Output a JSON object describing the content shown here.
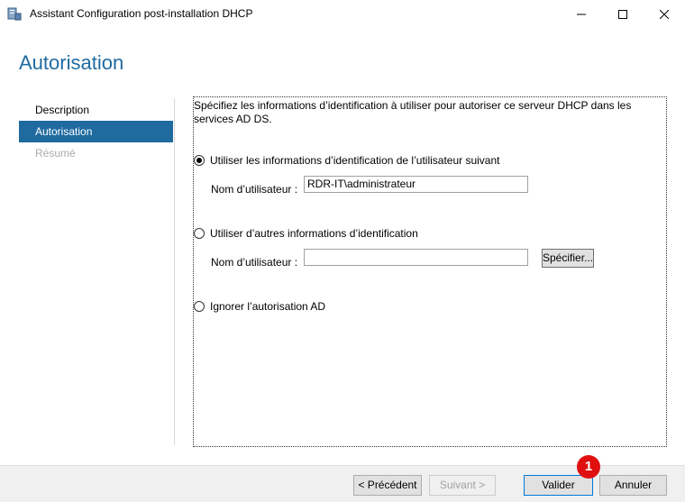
{
  "window": {
    "title": "Assistant Configuration post-installation DHCP",
    "icon": "server-wizard-icon"
  },
  "page_title": "Autorisation",
  "nav": {
    "items": [
      {
        "label": "Description",
        "state": "normal"
      },
      {
        "label": "Autorisation",
        "state": "active"
      },
      {
        "label": "Résumé",
        "state": "disabled"
      }
    ]
  },
  "main": {
    "intro": "Spécifiez les informations d’identification à utiliser pour autoriser ce serveur DHCP dans les services AD DS.",
    "option_current_user": {
      "label": "Utiliser les informations d’identification de l’utilisateur suivant",
      "checked": true,
      "username_label": "Nom d’utilisateur :",
      "username_value": "RDR-IT\\administrateur"
    },
    "option_other_user": {
      "label": "Utiliser d’autres informations d’identification",
      "checked": false,
      "username_label": "Nom d’utilisateur :",
      "username_value": "",
      "specify_label": "Spécifier..."
    },
    "option_skip": {
      "label": "Ignorer l’autorisation AD",
      "checked": false
    }
  },
  "footer": {
    "prev_label": "< Précédent",
    "next_label": "Suivant >",
    "ok_label": "Valider",
    "cancel_label": "Annuler"
  },
  "annotation": {
    "badge": "1"
  },
  "colors": {
    "accent": "#1f6ba0",
    "badge": "#e01010"
  }
}
